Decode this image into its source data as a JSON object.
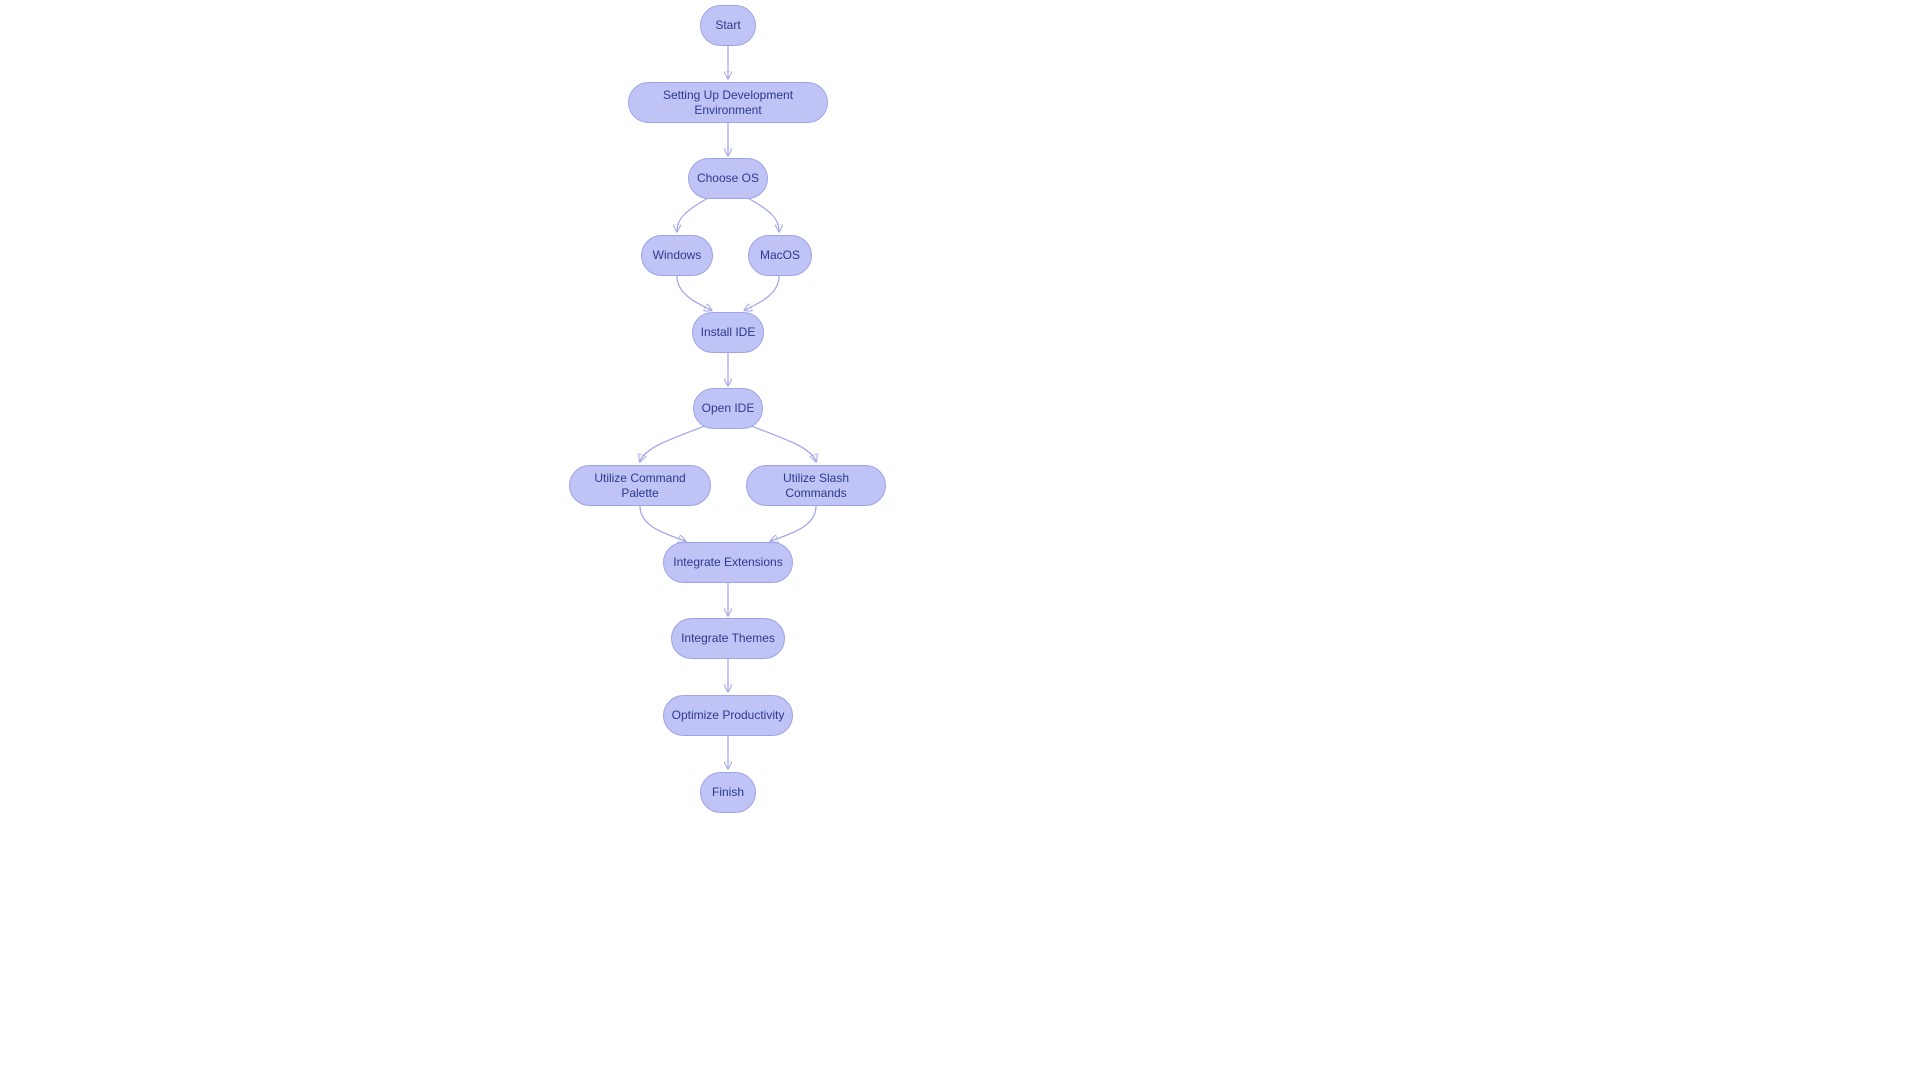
{
  "colors": {
    "node_fill": "#bfc3f6",
    "node_stroke": "#9ea3e8",
    "edge": "#9ea3e8",
    "text": "#2d3a8c"
  },
  "flow": {
    "nodes": {
      "start": {
        "label": "Start"
      },
      "setup": {
        "label": "Setting Up Development Environment"
      },
      "choose": {
        "label": "Choose OS"
      },
      "windows": {
        "label": "Windows"
      },
      "macos": {
        "label": "MacOS"
      },
      "install": {
        "label": "Install IDE"
      },
      "open": {
        "label": "Open IDE"
      },
      "palette": {
        "label": "Utilize Command Palette"
      },
      "slash": {
        "label": "Utilize Slash Commands"
      },
      "ext": {
        "label": "Integrate Extensions"
      },
      "themes": {
        "label": "Integrate Themes"
      },
      "opt": {
        "label": "Optimize Productivity"
      },
      "finish": {
        "label": "Finish"
      }
    }
  }
}
